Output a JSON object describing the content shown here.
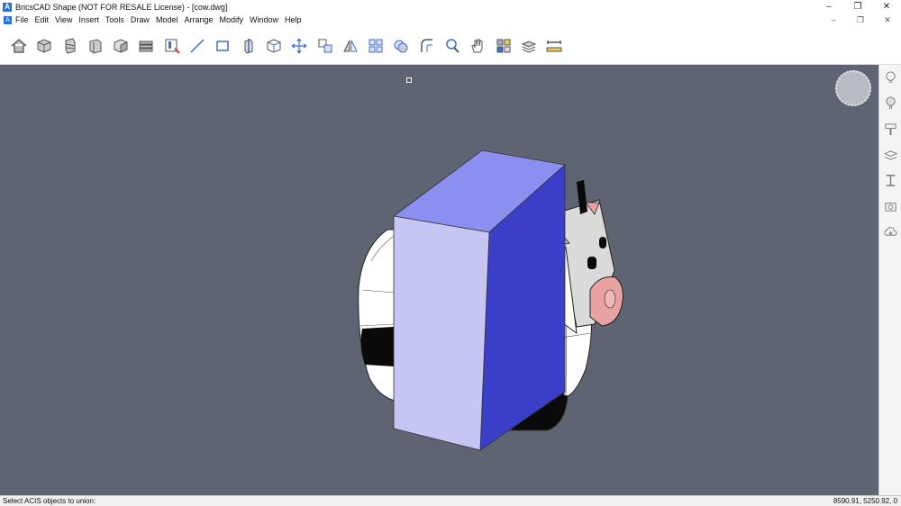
{
  "window": {
    "title": "BricsCAD Shape (NOT FOR RESALE License) - [cow.dwg]",
    "app_icon": "A",
    "minimize": "–",
    "maximize": "❐",
    "close": "✕"
  },
  "menu": {
    "items": [
      "File",
      "Edit",
      "View",
      "Insert",
      "Tools",
      "Draw",
      "Model",
      "Arrange",
      "Modify",
      "Window",
      "Help"
    ],
    "doc_minimize": "–",
    "doc_restore": "❐",
    "doc_close": "✕"
  },
  "toolbar": {
    "tools": [
      "home-icon",
      "box-icon",
      "wedge-stack-icon",
      "cylinder-icon",
      "solid-box-icon",
      "stairs-icon",
      "window-panel-icon",
      "line-icon",
      "rectangle-icon",
      "extrude-icon",
      "box-edit-icon",
      "move-icon",
      "copy-icon",
      "mirror-icon",
      "array-icon",
      "union-icon",
      "fillet-icon",
      "zoom-icon",
      "pan-icon",
      "material-icon",
      "layers-stack-icon",
      "dimension-icon"
    ]
  },
  "right_panel": {
    "icons": [
      "lightbulb-icon",
      "bulb-outline-icon",
      "paint-roller-icon",
      "layers-icon",
      "ibeam-icon",
      "camera-icon",
      "cloud-icon"
    ]
  },
  "colors": {
    "viewport_bg": "#5f6472",
    "box_front": "#c5c6f4",
    "box_top": "#8b8ff0",
    "box_side": "#3a3ec8",
    "cow_white": "#ffffff",
    "cow_black": "#0a0a0a",
    "cow_pink": "#e9a2a2"
  },
  "status": {
    "prompt": "Select ACIS objects to union:",
    "coords": "8590.91, 5250.92, 0"
  }
}
